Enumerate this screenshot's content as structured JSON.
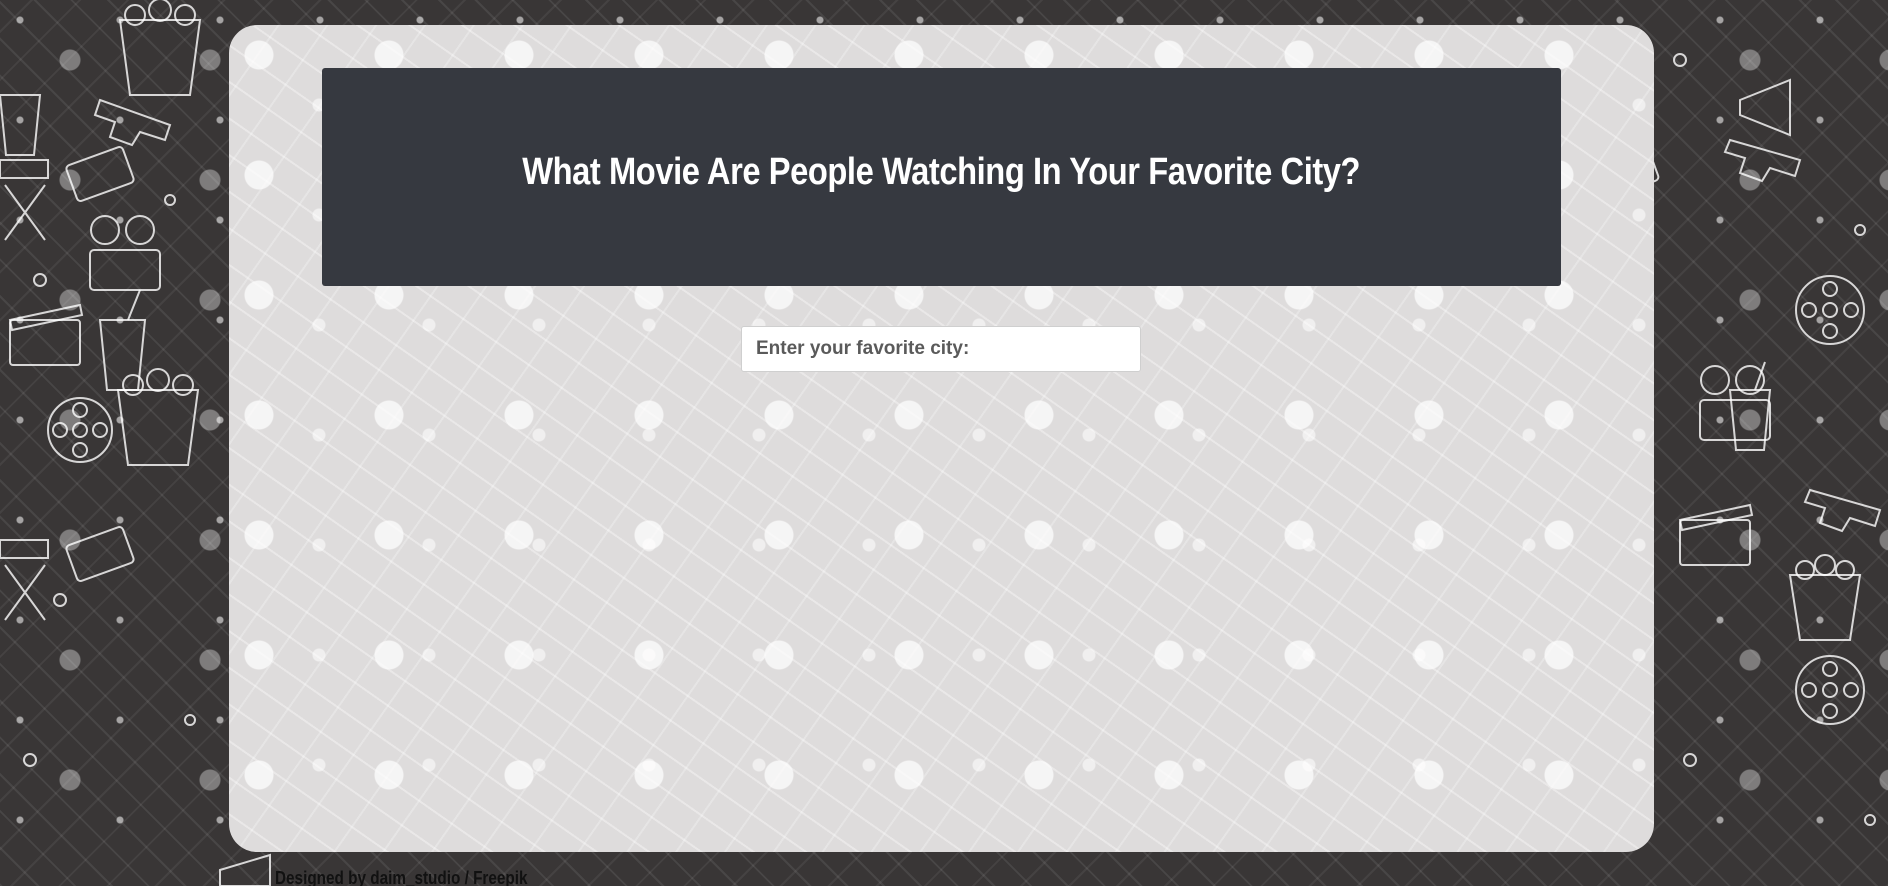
{
  "page": {
    "title": "What Movie Are People Watching In Your Favorite City?"
  },
  "search": {
    "placeholder": "Enter your favorite city:",
    "value": ""
  },
  "footer": {
    "credit": "Designed by daim_studio / Freepik"
  },
  "background": {
    "pattern_icons": [
      "popcorn-icon",
      "film-reel-icon",
      "ticket-icon",
      "3d-glasses-icon",
      "clapperboard-icon",
      "director-chair-icon",
      "movie-camera-icon",
      "soda-cup-icon",
      "megaphone-icon"
    ]
  },
  "colors": {
    "page_background": "#393636",
    "card_background": "#dedcdc",
    "header_background": "#363940",
    "header_text": "#ffffff"
  }
}
